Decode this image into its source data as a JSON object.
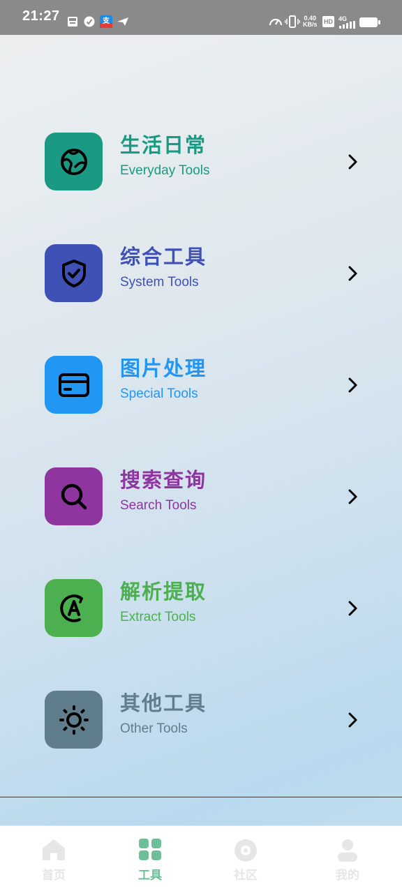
{
  "status_bar": {
    "time": "21:27",
    "speed_value": "0.40",
    "speed_unit": "KB/s",
    "hd_badge": "HD",
    "network": "4G",
    "icons": [
      "notification-icon",
      "check-icon",
      "app-icon",
      "send-icon",
      "speedometer-icon",
      "vibrate-icon",
      "hd-icon",
      "signal-icon",
      "battery-icon"
    ]
  },
  "menu": {
    "items": [
      {
        "title": "生活日常",
        "subtitle": "Everyday Tools",
        "color": "#1a9a82",
        "icon": "globe-icon"
      },
      {
        "title": "综合工具",
        "subtitle": "System Tools",
        "color": "#3f51b5",
        "icon": "shield-check-icon"
      },
      {
        "title": "图片处理",
        "subtitle": "Special Tools",
        "color": "#2196f3",
        "icon": "card-icon"
      },
      {
        "title": "搜索查询",
        "subtitle": "Search Tools",
        "color": "#8e35a0",
        "icon": "search-icon"
      },
      {
        "title": "解析提取",
        "subtitle": "Extract Tools",
        "color": "#4caf50",
        "icon": "extract-a-icon"
      },
      {
        "title": "其他工具",
        "subtitle": "Other Tools",
        "color": "#607d8b",
        "icon": "sun-icon"
      }
    ]
  },
  "bottom_nav": {
    "active_color": "#6cbf98",
    "inactive_color": "#e6e6e6",
    "items": [
      {
        "label": "首页",
        "icon": "home-icon",
        "active": false
      },
      {
        "label": "工具",
        "icon": "grid-icon",
        "active": true
      },
      {
        "label": "社区",
        "icon": "disc-icon",
        "active": false
      },
      {
        "label": "我的",
        "icon": "user-icon",
        "active": false
      }
    ]
  }
}
